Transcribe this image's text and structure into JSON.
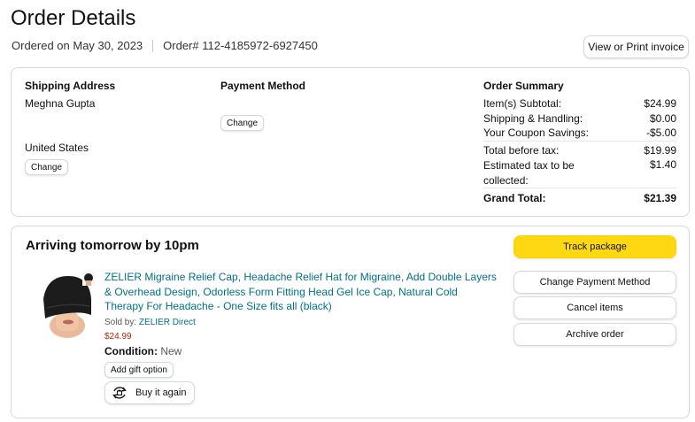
{
  "header": {
    "title": "Order Details",
    "ordered_on": "Ordered on May 30, 2023",
    "order_number": "Order# 112-4185972-6927450",
    "invoice_label": "View or Print invoice"
  },
  "shipping": {
    "heading": "Shipping Address",
    "name": "Meghna Gupta",
    "country": "United States",
    "change_label": "Change"
  },
  "payment": {
    "heading": "Payment Method",
    "change_label": "Change"
  },
  "summary": {
    "heading": "Order Summary",
    "rows": [
      {
        "label": "Item(s) Subtotal:",
        "value": "$24.99"
      },
      {
        "label": "Shipping & Handling:",
        "value": "$0.00"
      },
      {
        "label": "Your Coupon Savings:",
        "value": "-$5.00"
      },
      {
        "label": "Total before tax:",
        "value": "$19.99"
      },
      {
        "label": "Estimated tax to be collected:",
        "value": "$1.40"
      }
    ],
    "grand_total_label": "Grand Total:",
    "grand_total_value": "$21.39"
  },
  "shipment": {
    "arrival": "Arriving tomorrow by 10pm",
    "product_title": "ZELIER Migraine Relief Cap, Headache Relief Hat for Migraine, Add Double Layers & Overhead Design, Odorless Form Fitting Head Gel Ice Cap, Natural Cold Therapy For Headache - One Size fits all (black)",
    "sold_by_label": "Sold by:",
    "seller": "ZELIER Direct",
    "price": "$24.99",
    "condition_label": "Condition:",
    "condition_value": "New",
    "gift_label": "Add gift option",
    "buy_again_label": "Buy it again",
    "buy_again_icon": "buy-again-icon"
  },
  "actions": {
    "track": "Track package",
    "change_payment": "Change Payment Method",
    "cancel": "Cancel items",
    "archive": "Archive order"
  },
  "colors": {
    "link": "#007185",
    "price": "#b12704",
    "primary_button": "#ffd814",
    "border": "#d5d9d9"
  }
}
